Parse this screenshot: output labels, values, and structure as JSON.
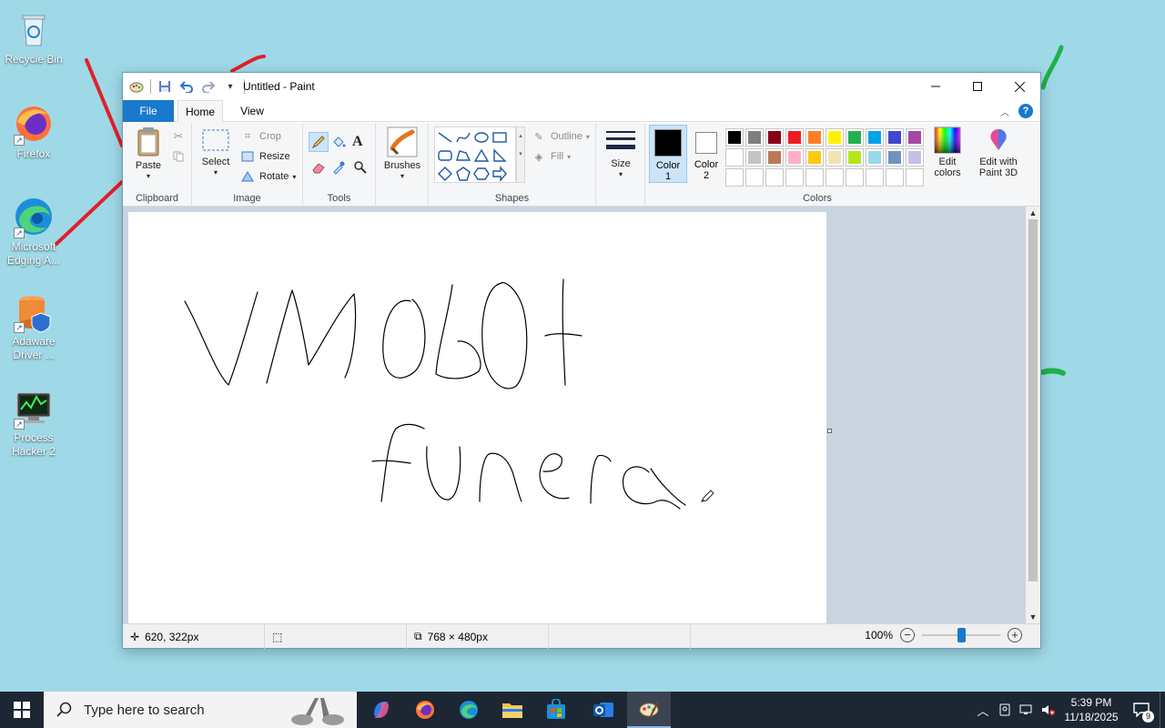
{
  "desktop": {
    "icons": [
      {
        "label": "Recycle Bin",
        "icon": "recycle-bin-icon"
      },
      {
        "label": "Firefox",
        "icon": "firefox-icon"
      },
      {
        "label": "Microsoft Edging A...",
        "icon": "edge-icon"
      },
      {
        "label": "Adaware Driver ...",
        "icon": "adaware-icon"
      },
      {
        "label": "Process Hacker 2",
        "icon": "process-hacker-icon"
      }
    ]
  },
  "window": {
    "title": "Untitled - Paint",
    "tabs": {
      "file": "File",
      "home": "Home",
      "view": "View"
    }
  },
  "ribbon": {
    "clipboard": {
      "group": "Clipboard",
      "paste": "Paste"
    },
    "image": {
      "group": "Image",
      "select": "Select",
      "crop": "Crop",
      "resize": "Resize",
      "rotate": "Rotate"
    },
    "tools": {
      "group": "Tools"
    },
    "brushes": {
      "label": "Brushes"
    },
    "shapes": {
      "group": "Shapes",
      "outline": "Outline",
      "fill": "Fill"
    },
    "size": {
      "label": "Size"
    },
    "colors": {
      "group": "Colors",
      "color1_label": "Color",
      "color1_num": "1",
      "color2_label": "Color",
      "color2_num": "2",
      "color1_value": "#000000",
      "color2_value": "#ffffff",
      "edit_colors": "Edit colors",
      "edit_paint3d": "Edit with Paint 3D",
      "palette": [
        "#000000",
        "#7f7f7f",
        "#880015",
        "#ed1c24",
        "#ff7f27",
        "#fff200",
        "#22b14c",
        "#00a2e8",
        "#3f48cc",
        "#a349a4",
        "#ffffff",
        "#c3c3c3",
        "#b97a57",
        "#ffaec9",
        "#ffc90e",
        "#efe4b0",
        "#b5e61d",
        "#99d9ea",
        "#7092be",
        "#c8bfe7",
        "",
        "",
        "",
        "",
        "",
        "",
        "",
        "",
        "",
        ""
      ]
    }
  },
  "status": {
    "cursor_pos": "620, 322px",
    "canvas_size": "768 × 480px",
    "zoom": "100%",
    "zoom_level": 50
  },
  "taskbar": {
    "search_placeholder": "Type here to search",
    "time": "5:39 PM",
    "date": "11/18/2025",
    "notification_count": "9"
  }
}
